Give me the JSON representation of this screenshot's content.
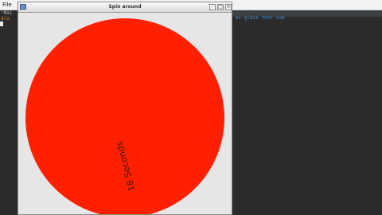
{
  "ide": {
    "menu_file": "File",
    "line_1": "'Mai",
    "line_2": "dra",
    "code_fragment": "ec glass test sum"
  },
  "window": {
    "title": "Spin around",
    "controls": {
      "minimize": "-",
      "maximize": "□",
      "close": "×"
    },
    "disc_color": "#ff2000",
    "rotated_label": "18 Seconds"
  }
}
